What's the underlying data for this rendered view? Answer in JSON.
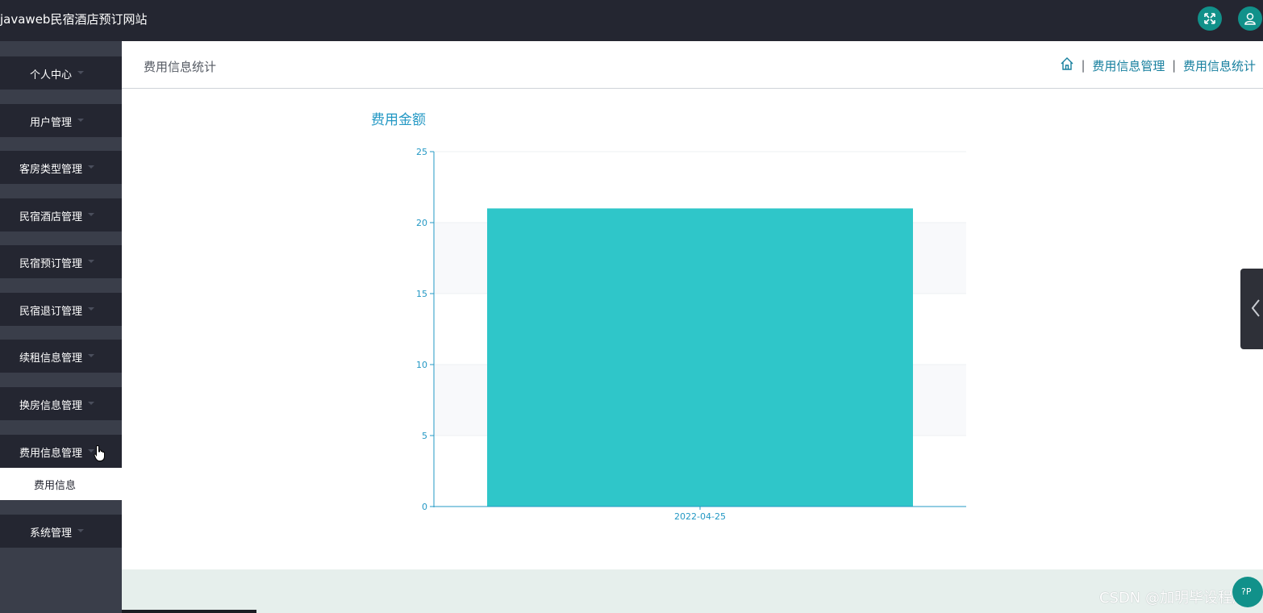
{
  "app": {
    "title": "javaweb民宿酒店预订网站"
  },
  "topbar": {
    "fullscreen_icon": "fullscreen-icon",
    "user_icon": "user-icon"
  },
  "sidebar": {
    "items": [
      {
        "label": "个人中心"
      },
      {
        "label": "用户管理"
      },
      {
        "label": "客房类型管理"
      },
      {
        "label": "民宿酒店管理"
      },
      {
        "label": "民宿预订管理"
      },
      {
        "label": "民宿退订管理"
      },
      {
        "label": "续租信息管理"
      },
      {
        "label": "换房信息管理"
      },
      {
        "label": "费用信息管理"
      },
      {
        "label": "系统管理"
      }
    ],
    "active_sub": {
      "label": "费用信息"
    }
  },
  "header": {
    "page_title": "费用信息统计",
    "breadcrumb": [
      "费用信息管理",
      "费用信息统计"
    ],
    "separator": "|"
  },
  "chart_data": {
    "type": "bar",
    "title": "费用金额",
    "categories": [
      "2022-04-25"
    ],
    "values": [
      21
    ],
    "ylim": [
      0,
      25
    ],
    "yticks": [
      0,
      5,
      10,
      15,
      20,
      25
    ],
    "grid": true,
    "colors": {
      "bar": "#2fc6c9",
      "axis": "#2398c4",
      "band": "#f8f9fb"
    }
  },
  "watermark": "CSDN @加明毕设程序",
  "help_button": {
    "label": "?P"
  },
  "colors": {
    "topbar": "#242631",
    "accent": "#11918a",
    "link": "#167f9e"
  }
}
